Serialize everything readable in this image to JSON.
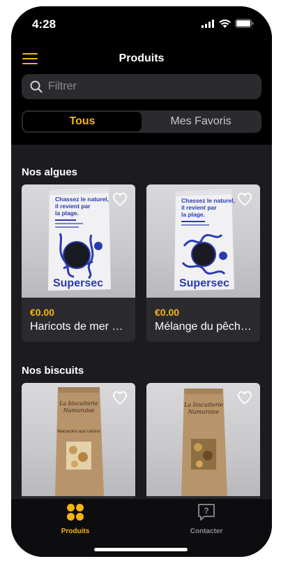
{
  "status": {
    "time": "4:28"
  },
  "header": {
    "title": "Produits"
  },
  "search": {
    "placeholder": "Filtrer"
  },
  "segments": [
    {
      "label": "Tous"
    },
    {
      "label": "Mes Favoris"
    }
  ],
  "sections": [
    {
      "title": "Nos algues",
      "products": [
        {
          "price": "€0.00",
          "name": "Haricots de mer séchés",
          "bag_text": "Chassez le naturel, il revient par la plage.",
          "brand": "Supersec"
        },
        {
          "price": "€0.00",
          "name": "Mélange du pêcheur",
          "bag_text": "Chassez le naturel, il revient par la plage.",
          "brand": "Supersec"
        }
      ]
    },
    {
      "title": "Nos biscuits",
      "products": [
        {
          "bag_brand": "La biscuiterie Namuroise",
          "bag_label": "Macarons aux raisins"
        },
        {
          "bag_brand": "La biscuiterie Namuroise",
          "bag_label": ""
        }
      ]
    }
  ],
  "tabbar": [
    {
      "label": "Produits"
    },
    {
      "label": "Contacter"
    }
  ],
  "colors": {
    "accent": "#f5b414",
    "background": "#1c1c20",
    "card": "#2a2a2f"
  }
}
